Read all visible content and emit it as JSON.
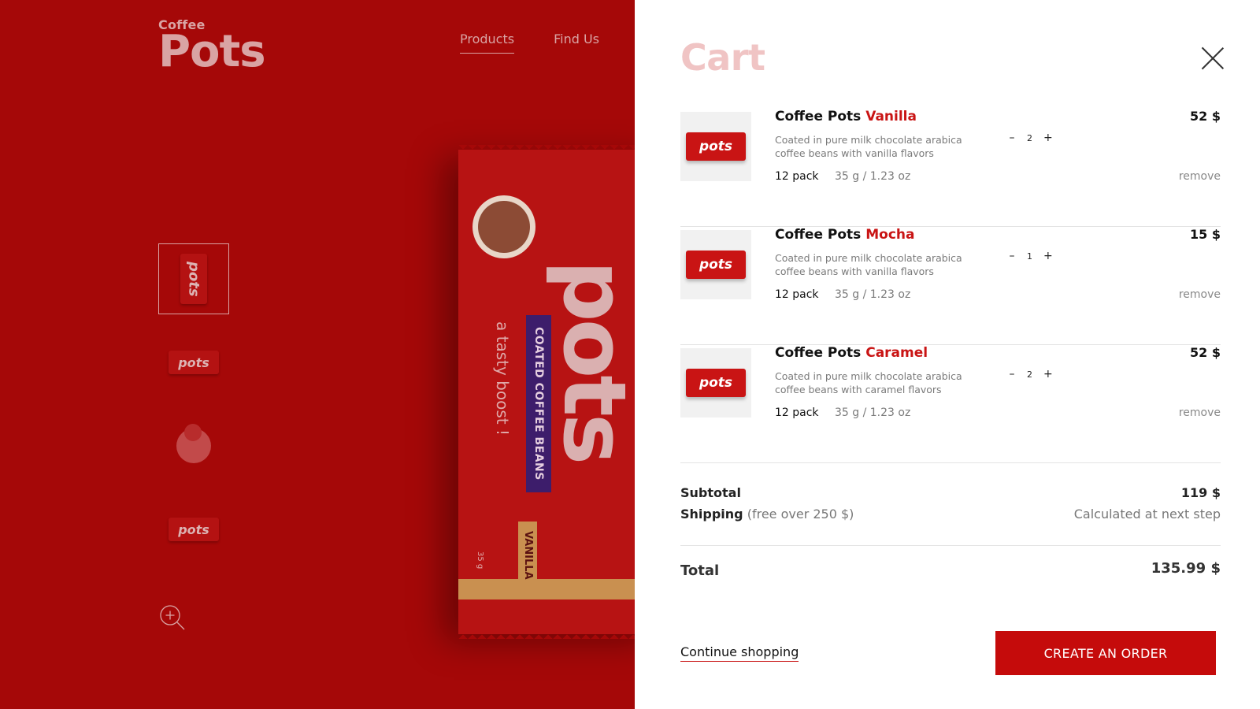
{
  "brand": {
    "small": "Coffee",
    "big": "Pots"
  },
  "nav": {
    "products": "Products",
    "find_us": "Find Us"
  },
  "pack": {
    "logo": "pots",
    "ribbon": "COATED COFFEE BEANS",
    "tagline": "a tasty boost !",
    "flavor": "VANILLA",
    "weight": "35 g",
    "thumb_logo": "pots"
  },
  "cart": {
    "title": "Cart",
    "items": [
      {
        "name": "Coffee Pots",
        "flavor": "Vanilla",
        "desc": "Coated in pure milk chocolate arabica coffee beans with vanilla flavors",
        "pack": "12 pack",
        "weight": "35 g / 1.23 oz",
        "qty": "2",
        "price": "52 $",
        "remove": "remove"
      },
      {
        "name": "Coffee Pots",
        "flavor": "Mocha",
        "desc": "Coated in pure milk chocolate arabica coffee beans with vanilla flavors",
        "pack": "12 pack",
        "weight": "35 g / 1.23 oz",
        "qty": "1",
        "price": "15 $",
        "remove": "remove"
      },
      {
        "name": "Coffee Pots",
        "flavor": "Caramel",
        "desc": "Coated in pure milk chocolate arabica coffee beans with caramel flavors",
        "pack": "12 pack",
        "weight": "35 g / 1.23 oz",
        "qty": "2",
        "price": "52 $",
        "remove": "remove"
      }
    ],
    "qty_minus": "–",
    "qty_plus": "+",
    "subtotal_label": "Subtotal",
    "subtotal_value": "119 $",
    "shipping_label": "Shipping",
    "shipping_note": "(free over 250 $)",
    "shipping_value": "Calculated at next step",
    "total_label": "Total",
    "total_value": "135.99 $",
    "continue": "Continue shopping",
    "order_button": "CREATE AN ORDER"
  },
  "colors": {
    "accent": "#c50b0b",
    "overlay_red": "#a50808",
    "cart_title": "#f0c4c4"
  }
}
